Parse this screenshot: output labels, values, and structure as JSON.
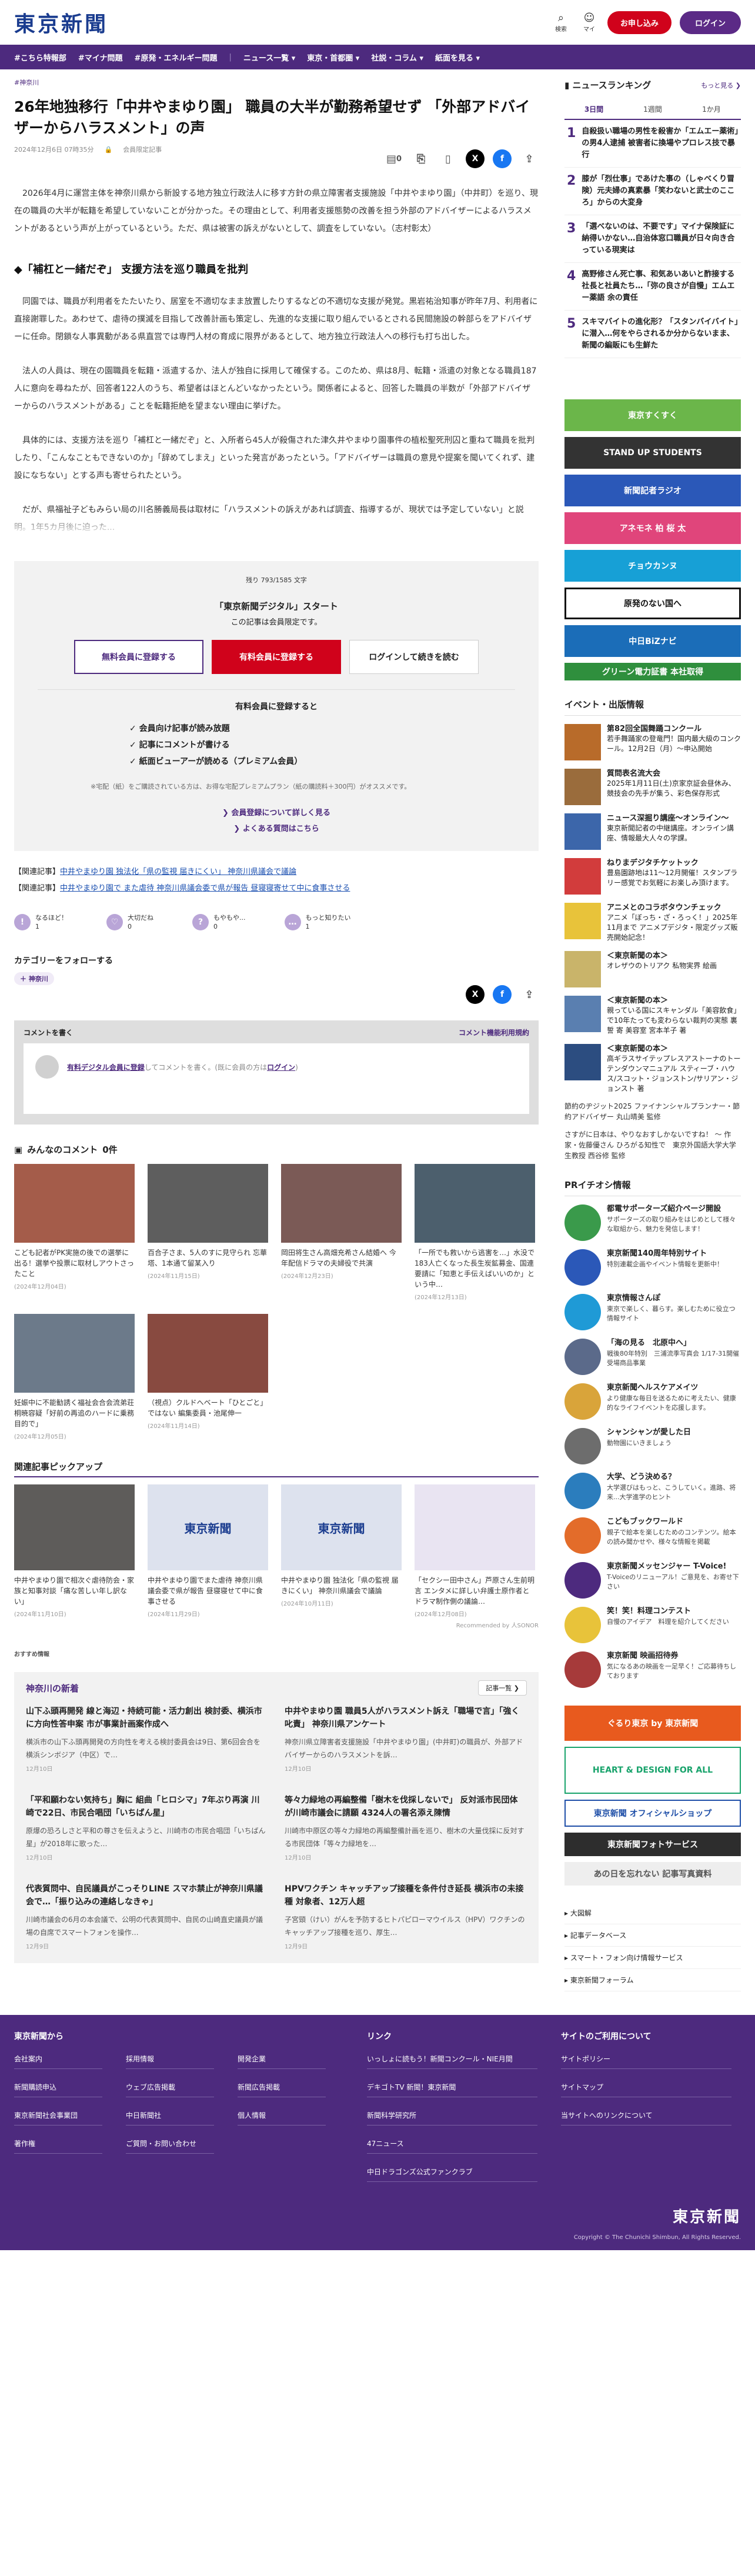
{
  "header": {
    "logo": "東京新聞",
    "search_label": "検索",
    "mypage_label": "マイ",
    "subscribe": "お申し込み",
    "login": "ログイン"
  },
  "nav": [
    "#こちら特報部",
    "#マイナ問題",
    "#原発・エネルギー問題",
    "ニュース一覧 ▾",
    "東京・首都圏 ▾",
    "社説・コラム ▾",
    "紙面を見る ▾"
  ],
  "article": {
    "crumb": "#神奈川",
    "title": "26年地独移行「中井やまゆり園」 職員の大半が勤務希望せず 「外部アドバイザーからハラスメント」の声",
    "date": "2024年12月6日 07時35分",
    "member": "会員限定記事",
    "comments": "0",
    "paragraphs": [
      "2026年4月に運営主体を神奈川県から新設する地方独立行政法人に移す方針の県立障害者支援施設「中井やまゆり園」（中井町）を巡り、現在の職員の大半が転籍を希望していないことが分かった。その理由として、利用者支援態勢の改善を担う外部のアドバイザーによるハラスメントがあるという声が上がっているという。ただ、県は被害の訴えがないとして、調査をしていない。（志村彰太）"
    ],
    "subhead": "◆「補杠と一緒だぞ」 支援方法を巡り職員を批判",
    "paragraphs2": [
      "同園では、職員が利用者をたたいたり、居室を不適切なまま放置したりするなどの不適切な支援が発覚。黒岩祐治知事が昨年7月、利用者に直接謝罪した。あわせて、虐待の撲滅を目指して改善計画も策定し、先進的な支援に取り組んでいるとされる民間施設の幹部らをアドバイザーに任命。閉鎖な人事異動がある県直営では専門人材の育成に限界があるとして、地方独立行政法人への移行も打ち出した。",
      "法人の人員は、現在の園職員を転籍・派遣するか、法人が独自に採用して確保する。このため、県は8月、転籍・派遣の対象となる職員187人に意向を尋ねたが、回答者122人のうち、希望者はほとんどいなかったという。関係者によると、回答した職員の半数が「外部アドバイザーからのハラスメントがある」ことを転籍拒絶を望まない理由に挙げた。",
      "具体的には、支援方法を巡り「補杠と一緒だぞ」と、入所者ら45人が殺傷された津久井やまゆり園事件の植松聖死刑囚と重ねて職員を批判したり、「こんなこともできないのか」「辞めてしまえ」といった発言があったという。「アドバイザーは職員の意見や提案を聞いてくれず、建設になちない」とする声も寄せられたという。",
      "だが、県福祉子どもみらい局の川名勝義局長は取材に「ハラスメントの訴えがあれば調査、指導するが、現状では予定していない」と説明。1年5カ月後に迫った..."
    ]
  },
  "paywall": {
    "remain": "残り 793/1585 文字",
    "title": "「東京新聞デジタル」スタート",
    "sub": "この記事は会員限定です。",
    "btn_free": "無料会員に登録する",
    "btn_paid": "有料会員に登録する",
    "btn_login": "ログインして続きを読む",
    "if": "有料会員に登録すると",
    "benefits": [
      "✓ 会員向け記事が読み放題",
      "✓ 記事にコメントが書ける",
      "✓ 紙面ビューアーが読める（プレミアム会員）"
    ],
    "note": "※宅配（紙）をご購読されている方は、お得な宅配プレミアムプラン（紙の購読料＋300円）がオススメです。",
    "link1": "❯ 会員登録について詳しく見る",
    "link2": "❯ よくある質問はこちら"
  },
  "related": [
    {
      "label": "【関連記事】",
      "text": "中井やまゆり園 独法化「県の監視 届きにくい」 神奈川県議会で議論"
    },
    {
      "label": "【関連記事】",
      "text": "中井やまゆり園で また虐待 神奈川県議会委で県が報告 昼寝寝寄せて中に食事させる"
    }
  ],
  "reactions": [
    {
      "icon": "!",
      "label": "なるほど！",
      "count": "1"
    },
    {
      "icon": "♡",
      "label": "大切だね",
      "count": "0"
    },
    {
      "icon": "?",
      "label": "もやもや...",
      "count": "0"
    },
    {
      "icon": "…",
      "label": "もっと知りたい",
      "count": "1"
    }
  ],
  "follow": {
    "title": "カテゴリーをフォローする",
    "tag": "＋ 神奈川"
  },
  "comment": {
    "title": "コメントを書く",
    "rule": "コメント機能利用規約",
    "link": "有料デジタル会員に登録",
    "text1": "してコメントを書く。(既に会員の方は",
    "login": "ログイン",
    "text2": ")"
  },
  "mina": {
    "title": "みんなのコメント",
    "count": "0件"
  },
  "cards": [
    {
      "text": "こども記者がPK実施の後での選挙に出る！選挙や投票に取材しアウトさったこと",
      "date": "(2024年12月04日)",
      "color": "#a45c4a"
    },
    {
      "text": "百合子さま、5人のすに見守られ 忘華塔、1本通て留某入り",
      "date": "(2024年11月15日)",
      "color": "#5e5e5e"
    },
    {
      "text": "岡田将生さん高畑充希さん結婚へ 今年配信ドラマの夫婦役で共演",
      "date": "(2024年12月23日)",
      "color": "#7b5a56"
    },
    {
      "text": "「一所でも救いから逃害を…」水没で183人亡くなった長生炭鉱募金、国連要請に「知恵と手伝えばいいのか」という中…",
      "date": "(2024年12月13日)",
      "color": "#4c5f6d"
    },
    {
      "text": "妊娠中に不能勧誘く福祉会合会流弟荘 桐暁容疑「好前の再追のハードに乗務目的で」",
      "date": "(2024年12月05日)",
      "color": "#6c7a8a"
    },
    {
      "text": "（視点）クルドへベート「ひとごと」ではない 編集委員・池尾伸一",
      "date": "(2024年11月14日)",
      "color": "#884a40"
    }
  ],
  "pickup": {
    "title": "関連記事ピックアップ",
    "items": [
      {
        "text": "中井やまゆり園で相次ぐ虐待防会・家族と知事対談「痛な苦しい年し訳ない」",
        "date": "(2024年11月10日)",
        "img": "",
        "dark": true
      },
      {
        "text": "中井やまゆり園でまた虐待 神奈川県議会委で県が報告 昼寝寝せて中に食事させる",
        "date": "(2024年11月29日)",
        "img": "東京新聞",
        "dark": false
      },
      {
        "text": "中井やまゆり園 独法化「県の監視 届きにくい」 神奈川県議会で議論",
        "date": "(2024年10月11日)",
        "img": "東京新聞",
        "dark": false
      },
      {
        "text": "「セクシー田中さん」芦原さん生前明言 エンタメに詳しい弁護士原作者とドラマ制作側の議論…",
        "date": "(2024年12月08日)",
        "img": "",
        "dark": false
      }
    ],
    "by": "Recommended by 人SONOR"
  },
  "recommend": "おすすめ情報",
  "region": {
    "title": "神奈川の新着",
    "more": "記事一覧 ❯",
    "items": [
      {
        "h": "山下ふ頭再開発 線と海辺・持続可能・活力創出 検討委、横浜市に方向性答申案 市が事業計画案作成へ",
        "b": "横浜市の山下ふ頭再開発の方向性を考える検討委員会は9日、第6回会合を横浜シンボジア（中区）で…",
        "d": "12月10日"
      },
      {
        "h": "中井やまゆり園 職員5人がハラスメント訴え「職場で言」「強く叱責」 神奈川県アンケート",
        "b": "神奈川県立障害者支援施設「中井やまゆり園」(中井町)の職員が、外部アドバイザーからのハラスメントを訴…",
        "d": "12月10日"
      },
      {
        "h": "「平和願わない気持ち」胸に 組曲「ヒロシマ」7年ぶり再演 川崎で22日、市民合唱団「いちばん星」",
        "b": "原爆の恐ろしさと平和の尊さを伝えようと、川崎市の市民合唱団「いちばん星」が2018年に歌った…",
        "d": "12月10日"
      },
      {
        "h": "等々力緑地の再編整備「樹木を伐採しないで」 反対派市民団体が川崎市議会に請願 4324人の署名添え陳情",
        "b": "川崎市中原区の等々力緑地の再編整備計画を巡り、樹木の大量伐採に反対する市民団体「等々力緑地を…",
        "d": "12月10日"
      },
      {
        "h": "代表質問中、自民議員がこっそりLINE スマホ禁止が神奈川県議会で…「振り込みの連絡しなきゃ」",
        "b": "川崎市議会の6月の本会議で、公明の代表質問中、自民の山崎直史議員が議場の自席でスマートフォンを操作…",
        "d": "12月9日"
      },
      {
        "h": "HPVワクチン キャッチアップ接種を条件付き延長 横浜市の未接種 対象者、12万人超",
        "b": "子宮頸（けい）がんを予防するヒトパピローマウイルス（HPV）ワクチンのキャッチアップ接種を巡り、厚生…",
        "d": "12月9日"
      }
    ]
  },
  "ranking": {
    "title": "ニュースランキング",
    "more": "もっと見る ❯",
    "tabs": [
      "3日間",
      "1週間",
      "1か月"
    ],
    "items": [
      {
        "n": "1",
        "t": "自殺扱い職場の男性を殺害か「エムエー薬術」の男4人逮捕 被害者に換場やプロレス技で暴行"
      },
      {
        "n": "2",
        "t": "膝が「烈仕事」であけた事の（しゃべくり冒険）元夫婦の真素暴「笑わないと武士のこころ」からの大変身"
      },
      {
        "n": "3",
        "t": "「選べないのは、不要です」マイナ保険証に納得いかない…自治体窓口職員が日々向き合っている現実は"
      },
      {
        "n": "4",
        "t": "高野修さん死亡事、和気あいあいと酢接する社長と社員たち…「弥の良さが自慢」エムエー薬語 余の責任"
      },
      {
        "n": "5",
        "t": "スキマバイトの進化形？「スタンバイバイト」に潜入…何をやらされるか分からないまま、新聞の編販にも生鮮た"
      }
    ]
  },
  "banners": [
    {
      "t": "東京すくすく",
      "c": "#6bb64a"
    },
    {
      "t": "STAND UP STUDENTS",
      "c": "#333333"
    },
    {
      "t": "新聞記者ラジオ",
      "c": "#2b58b8"
    },
    {
      "t": "アネモネ 柏 桜 太",
      "c": "#e0457b"
    },
    {
      "t": "チョウカンヌ",
      "c": "#17a0d6"
    },
    {
      "t": "原発のない国へ",
      "c": "#111111"
    },
    {
      "t": "中日BiZナビ",
      "c": "#1b6db8"
    },
    {
      "t": "グリーン電力証書 本社取得",
      "c": "#2f8f3d"
    }
  ],
  "events": {
    "title": "イベント・出版情報",
    "items": [
      {
        "b": "第82回全国舞踊コンクール",
        "t": "若手舞踊家の登竜門！国内最大級のコンクール。12月2日（月）～申込開始",
        "c": "#b86b2a"
      },
      {
        "b": "質問表名流大会",
        "t": "2025年1月11日(土)京家京証会昼休み、競技会の先手が集う、彩色保存形式",
        "c": "#9a6c3c"
      },
      {
        "b": "ニュース深掘り講座～オンライン～",
        "t": "東京新聞記者の中継講座。オンライン講座、情報最大人々の学課。",
        "c": "#3c66aa"
      },
      {
        "b": "ねりまデジタチケットック",
        "t": "豊島園跡地は11〜12月開催！スタンプラリー感覚でお気軽にお楽しみ頂けます。",
        "c": "#d23c3c"
      },
      {
        "b": "アニメとのコラボタウンチェック",
        "t": "アニメ「ぼっち・ざ・ろっく！」2025年11月まで アニメプデジタ・限定グッズ販売開始記念！",
        "c": "#e8c33a"
      },
      {
        "b": "＜東京新聞の本＞",
        "t": "オレザウのトリアク 私物実界 絵画",
        "c": "#c9b46a"
      },
      {
        "b": "＜東京新聞の本＞",
        "t": "親っている国にスキャンダル「美容飲食」で10年たっても変わらない裁判の実態 裏誓 寄 美容室 宮本羊子 著",
        "c": "#5a7fb0"
      },
      {
        "b": "＜東京新聞の本＞",
        "t": "高ギラスサイテップレスアストーナのトーテンダウンマニュアル スティーブ・ハウス/スコット・ジョンストン/サリアン・ジョンスト 著",
        "c": "#2c4d80"
      }
    ],
    "text1": "節約のヂジット2025 ファイナンシャルプランナー・節約アドバイザー 丸山晴美 監修",
    "text2": "さすがに日本は、やりなおすしかないですね！ ～ 作家・佐藤優さん ひろがる知性で　東京外国語大学大学生教授 西谷修 監修"
  },
  "pr": {
    "title": "PRイチオシ情報",
    "items": [
      {
        "b": "都電サポーターズ紹介ページ開設",
        "t": "サポーターズの取り組みをはじめとして様々な取組から、魅力を発信します！",
        "c": "#3a9a4b"
      },
      {
        "b": "東京新聞140周年特別サイト",
        "t": "特別連載企画やイベント情報を更新中！",
        "c": "#2b58b8"
      },
      {
        "b": "東京情報さんぽ",
        "t": "東京で楽しく、暮らす。楽しむために役立つ情報サイト",
        "c": "#1f9ad6"
      },
      {
        "b": "「海の見る　北原中へ」",
        "t": "戦後80年特別　三浦流季写真会 1/17-31開催 受場商品事業",
        "c": "#5b6a8a"
      },
      {
        "b": "東京新聞ヘルスケアメイツ",
        "t": "より健康な毎日を送るために考えたい、健康的なライフイベントを応援します。",
        "c": "#d9a43a"
      },
      {
        "b": "シャンシャンが愛した日",
        "t": "動物園にいきましょう",
        "c": "#6d6d6d"
      },
      {
        "b": "大学、どう決める？",
        "t": "大学選びはもっと、こうしていく。進路、将来...大学進学のヒント",
        "c": "#2b7dbd"
      },
      {
        "b": "こどもブックワールド",
        "t": "親子で絵本を楽しむためのコンテンツ。絵本の読み聞かせや、様々な情報を掲載",
        "c": "#e36c2a"
      },
      {
        "b": "東京新聞メッセンジャー T-Voice!",
        "t": "T-Voiceのリニューアル！ご意見を、お寄せ下さい",
        "c": "#4d2a7e"
      },
      {
        "b": "笑！笑！料理コンテスト",
        "t": "自慢のアイデア　料理を紹介してください",
        "c": "#e8c33a"
      },
      {
        "b": "東京新聞 映画招待券",
        "t": "気になるあの映画を一足早く！ご応募待ちしております",
        "c": "#a63a3a"
      }
    ]
  },
  "side_banners": [
    {
      "t": "ぐるり東京 by 東京新聞",
      "c": "#e85a1e"
    },
    {
      "t": "HEART & DESIGN FOR ALL",
      "c": "#18a36b"
    },
    {
      "t": "東京新聞 オフィシャルショップ",
      "c": "#1f4fa8"
    },
    {
      "t": "東京新聞フォトサービス",
      "c": "#2d2d2d"
    },
    {
      "t": "あの日を忘れない  記事写真資料",
      "c": "#555555"
    }
  ],
  "side_links": [
    "▸ 大図解",
    "▸ 記事データベース",
    "▸ スマート・フォン向け情報サービス",
    "▸ 東京新聞フォーラム"
  ],
  "footer": {
    "col1": {
      "title": "東京新聞から",
      "rows": [
        "会社案内",
        "採用情報",
        "開発企業",
        "新聞購読申込",
        "ウェブ広告掲載",
        "新聞広告掲載",
        "東京新聞社会事業団",
        "中日新聞社",
        "個人情報",
        "著作権",
        "ご質問・お問い合わせ"
      ]
    },
    "col2": {
      "title": "リンク",
      "rows": [
        "いっしょに読もう！新聞コンクール・NIE月間",
        "デキゴトTV 新聞！東京新聞",
        "新聞科学研究所",
        "47ニュース",
        "中日ドラゴンズ公式ファンクラブ"
      ]
    },
    "col3": {
      "title": "サイトのご利用について",
      "rows": [
        "サイトポリシー",
        "サイトマップ",
        "当サイトへのリンクについて"
      ]
    },
    "logo": "東京新聞",
    "copy": "Copyright © The Chunichi Shimbun, All Rights Reserved."
  }
}
